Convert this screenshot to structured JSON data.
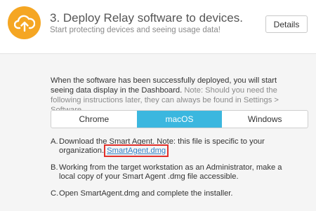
{
  "header": {
    "icon": "cloud-upload-icon",
    "accent_color": "#f5a623",
    "title": "3. Deploy Relay software to devices.",
    "subtitle": "Start protecting devices and seeing usage data!",
    "details_label": "Details"
  },
  "intro": {
    "text": "When the software has been successfully deployed, you will start seeing data display in the Dashboard.",
    "note": "Note: Should you need the following instructions later, they can always be found in Settings > Software."
  },
  "tabs": {
    "items": [
      "Chrome",
      "macOS",
      "Windows"
    ],
    "selected": "macOS",
    "active_color": "#3bb7df"
  },
  "steps": [
    {
      "letter": "A.",
      "text": "Download the Smart Agent. Note: this file is specific to your organization. ",
      "link": "SmartAgent.dmg"
    },
    {
      "letter": "B.",
      "text": "Working from the target workstation as an Administrator, make a local copy of your Smart Agent .dmg file accessible."
    },
    {
      "letter": "C.",
      "text": "Open SmartAgent.dmg and complete the installer."
    }
  ]
}
